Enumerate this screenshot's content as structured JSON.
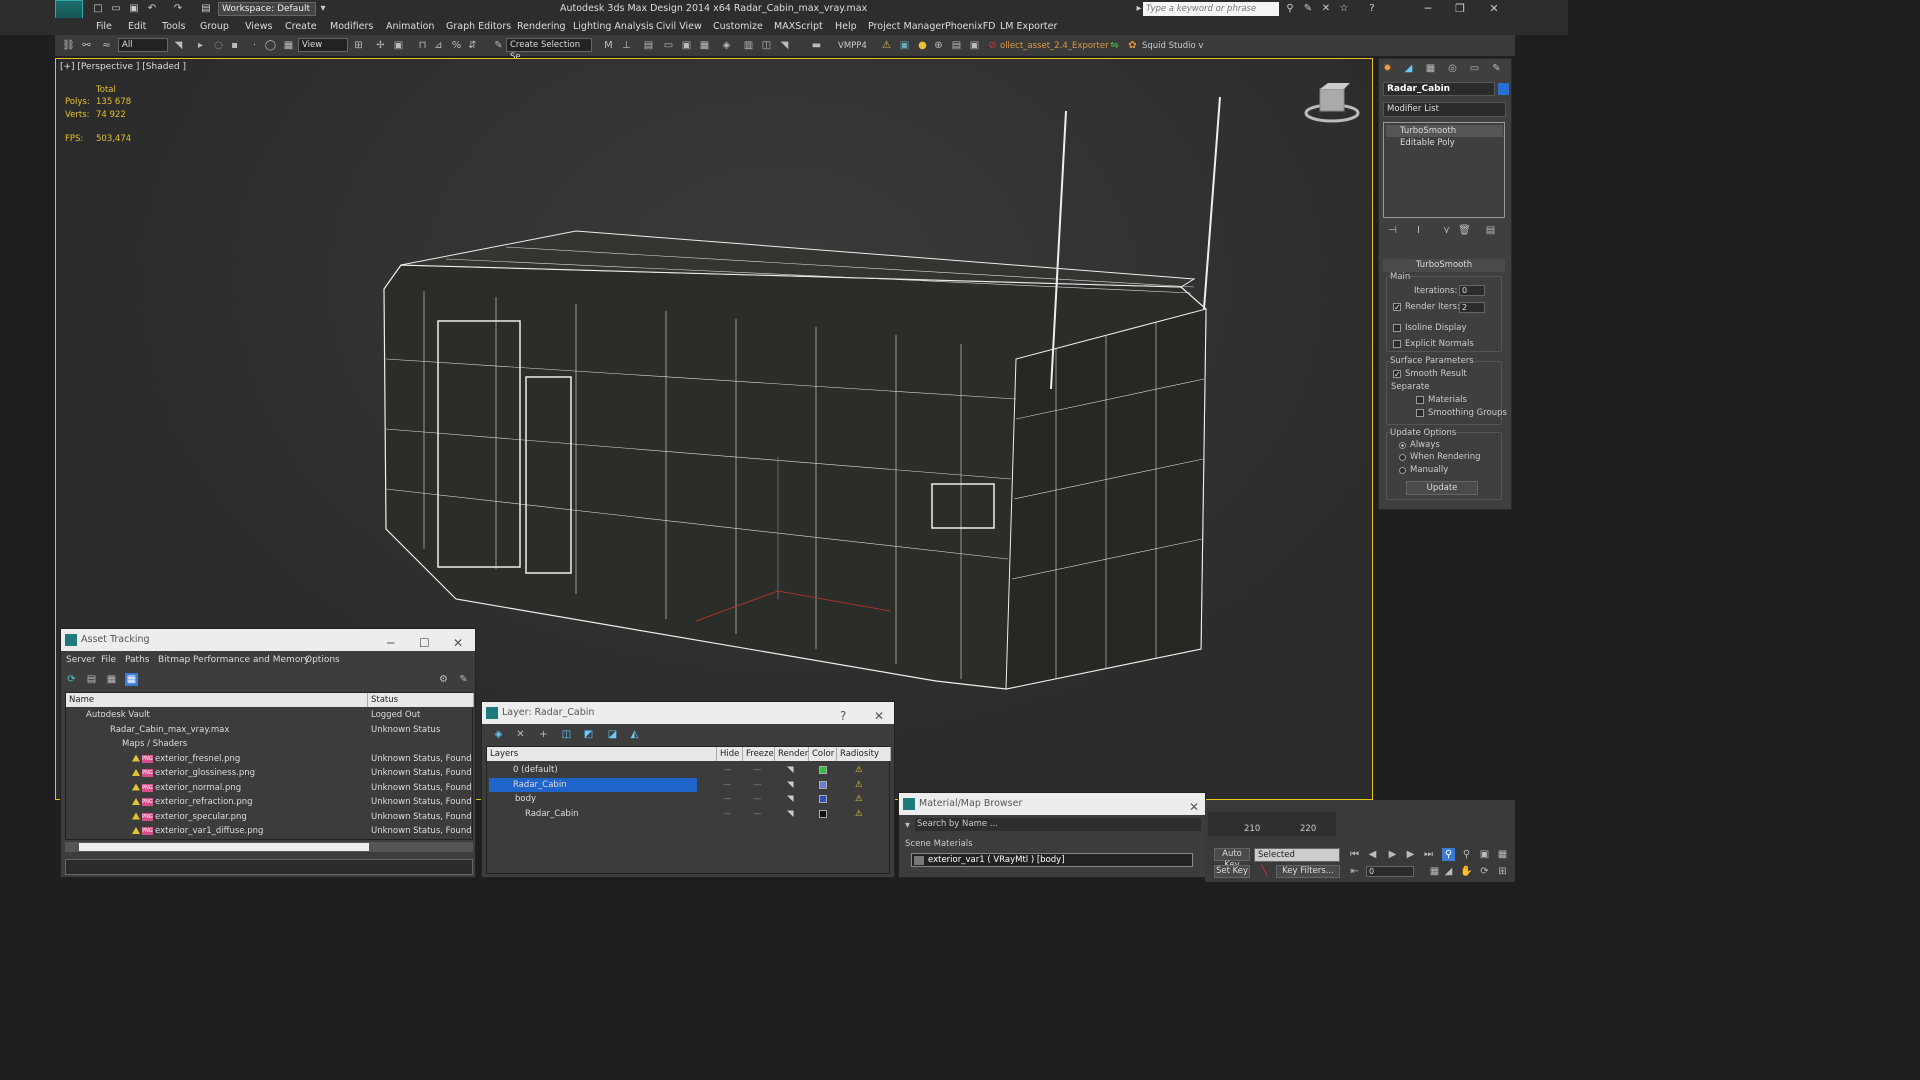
{
  "app": {
    "title": "Autodesk 3ds Max Design 2014 x64     Radar_Cabin_max_vray.max",
    "logo": "MXD",
    "workspace": "Workspace: Default",
    "search_placeholder": "Type a keyword or phrase"
  },
  "menu": [
    "File",
    "Edit",
    "Tools",
    "Group",
    "Views",
    "Create",
    "Modifiers",
    "Animation",
    "Graph Editors",
    "Rendering",
    "Lighting Analysis",
    "Civil View",
    "Customize",
    "MAXScript",
    "Help",
    "Project Manager",
    "PhoenixFD",
    "LM Exporter"
  ],
  "toolbar": {
    "filter": "All",
    "ref_coord": "View",
    "selection_set": "Create Selection Se",
    "vmpp": "VMPP4",
    "exporter": "ollect_asset_2.4_Exporter",
    "squid": "Squid Studio v"
  },
  "viewport": {
    "label": "[+] [Perspective ] [Shaded ]",
    "stats": {
      "total_label": "Total",
      "polys_label": "Polys:",
      "polys": "135 678",
      "verts_label": "Verts:",
      "verts": "74 922",
      "fps_label": "FPS:",
      "fps": "503,474"
    }
  },
  "command_panel": {
    "object_name": "Radar_Cabin",
    "modifier_list": "Modifier List",
    "stack": [
      "TurboSmooth",
      "Editable Poly"
    ],
    "rollout": "TurboSmooth",
    "main_label": "Main",
    "iterations_label": "Iterations:",
    "iterations": "0",
    "render_iters_label": "Render Iters:",
    "render_iters": "2",
    "isoline": "Isoline Display",
    "explicit": "Explicit Normals",
    "surface_label": "Surface Parameters",
    "smooth_result": "Smooth Result",
    "separate_label": "Separate",
    "materials": "Materials",
    "smoothing_groups": "Smoothing Groups",
    "update_label": "Update Options",
    "always": "Always",
    "when_rendering": "When Rendering",
    "manually": "Manually",
    "update_btn": "Update"
  },
  "asset_tracking": {
    "title": "Asset Tracking",
    "menu": [
      "Server",
      "File",
      "Paths",
      "Bitmap Performance and Memory",
      "Options"
    ],
    "columns": [
      "Name",
      "Status"
    ],
    "rows": [
      {
        "name": "Autodesk Vault",
        "status": "Logged Out"
      },
      {
        "name": "Radar_Cabin_max_vray.max",
        "status": "Unknown Status"
      },
      {
        "name": "Maps / Shaders",
        "status": ""
      },
      {
        "name": "exterior_fresnel.png",
        "status": "Unknown Status, Found"
      },
      {
        "name": "exterior_glossiness.png",
        "status": "Unknown Status, Found"
      },
      {
        "name": "exterior_normal.png",
        "status": "Unknown Status, Found"
      },
      {
        "name": "exterior_refraction.png",
        "status": "Unknown Status, Found"
      },
      {
        "name": "exterior_specular.png",
        "status": "Unknown Status, Found"
      },
      {
        "name": "exterior_var1_diffuse.png",
        "status": "Unknown Status, Found"
      }
    ]
  },
  "layer_panel": {
    "title": "Layer: Radar_Cabin",
    "help": "?",
    "columns": [
      "Layers",
      "Hide",
      "Freeze",
      "Render",
      "Color",
      "Radiosity"
    ],
    "rows": [
      {
        "name": "0 (default)",
        "color": "#2fbf3a"
      },
      {
        "name": "Radar_Cabin",
        "color": "#6a7fd8"
      },
      {
        "name": "body",
        "color": "#2a4fb8"
      },
      {
        "name": "Radar_Cabin",
        "color": "#111111"
      }
    ]
  },
  "material_browser": {
    "title": "Material/Map Browser",
    "search": "Search by Name ...",
    "section": "Scene Materials",
    "item": "exterior_var1  ( VRayMtl ) [body]"
  },
  "timeline": {
    "ticks": [
      "210",
      "220"
    ],
    "auto_key": "Auto Key",
    "selected": "Selected",
    "set_key": "Set Key",
    "key_filters": "Key Filters...",
    "frame": "0"
  }
}
